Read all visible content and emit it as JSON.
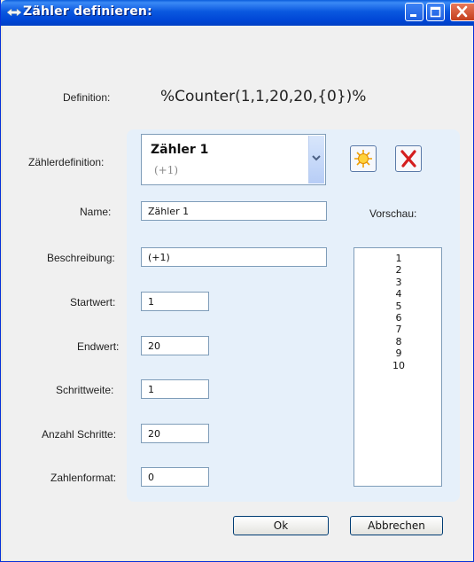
{
  "window": {
    "title": "Zähler definieren:"
  },
  "definition": {
    "label": "Definition:",
    "value": "%Counter(1,1,20,20,{0})%"
  },
  "counter": {
    "label": "Zählerdefinition:",
    "selected_name": "Zähler 1",
    "selected_desc": "(+1)"
  },
  "fields": {
    "name": {
      "label": "Name:",
      "value": "Zähler 1"
    },
    "beschreibung": {
      "label": "Beschreibung:",
      "value": "(+1)"
    },
    "startwert": {
      "label": "Startwert:",
      "value": "1"
    },
    "endwert": {
      "label": "Endwert:",
      "value": "20"
    },
    "schrittweite": {
      "label": "Schrittweite:",
      "value": "1"
    },
    "anzahl": {
      "label": "Anzahl Schritte:",
      "value": "20"
    },
    "zahlenformat": {
      "label": "Zahlenformat:",
      "value": "0"
    }
  },
  "preview": {
    "label": "Vorschau:",
    "items": [
      "1",
      "2",
      "3",
      "4",
      "5",
      "6",
      "7",
      "8",
      "9",
      "10"
    ]
  },
  "buttons": {
    "ok": "Ok",
    "cancel": "Abbrechen"
  },
  "icons": {
    "new": "new-star-icon",
    "delete": "delete-x-icon",
    "dropdown": "chevron-down-icon",
    "app": "app-icon"
  }
}
